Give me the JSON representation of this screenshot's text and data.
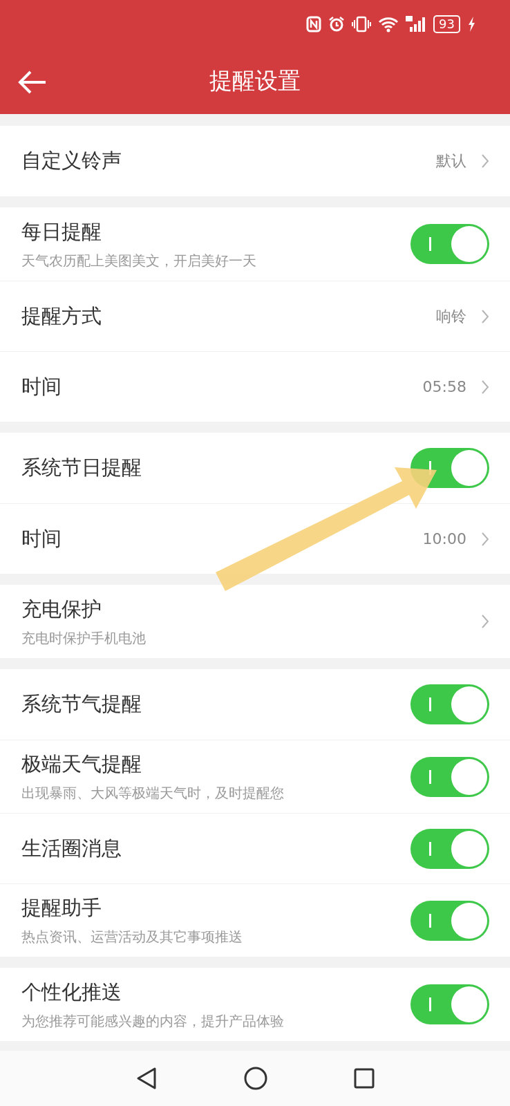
{
  "status_bar": {
    "battery": "93"
  },
  "header": {
    "title": "提醒设置"
  },
  "groups": [
    {
      "items": [
        {
          "kind": "link",
          "label": "自定义铃声",
          "value": "默认"
        }
      ]
    },
    {
      "items": [
        {
          "kind": "toggle",
          "label": "每日提醒",
          "subtitle": "天气农历配上美图美文，开启美好一天",
          "on": true
        },
        {
          "kind": "link",
          "label": "提醒方式",
          "value": "响铃"
        },
        {
          "kind": "link",
          "label": "时间",
          "value": "05:58"
        }
      ]
    },
    {
      "items": [
        {
          "kind": "toggle",
          "label": "系统节日提醒",
          "on": true
        },
        {
          "kind": "link",
          "label": "时间",
          "value": "10:00"
        }
      ]
    },
    {
      "items": [
        {
          "kind": "link",
          "label": "充电保护",
          "subtitle": "充电时保护手机电池"
        }
      ]
    },
    {
      "items": [
        {
          "kind": "toggle",
          "label": "系统节气提醒",
          "on": true
        },
        {
          "kind": "toggle",
          "label": "极端天气提醒",
          "subtitle": "出现暴雨、大风等极端天气时，及时提醒您",
          "on": true
        },
        {
          "kind": "toggle",
          "label": "生活圈消息",
          "on": true
        },
        {
          "kind": "toggle",
          "label": "提醒助手",
          "subtitle": "热点资讯、运营活动及其它事项推送",
          "on": true
        }
      ]
    },
    {
      "items": [
        {
          "kind": "toggle",
          "label": "个性化推送",
          "subtitle": "为您推荐可能感兴趣的内容，提升产品体验",
          "on": true
        }
      ]
    }
  ]
}
